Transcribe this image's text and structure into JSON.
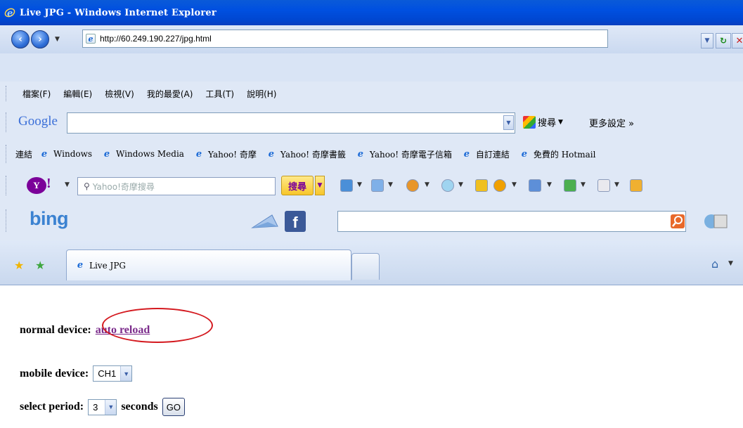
{
  "window": {
    "title": "Live JPG - Windows Internet Explorer"
  },
  "address": {
    "url": "http://60.249.190.227/jpg.html"
  },
  "menu": [
    "檔案(F)",
    "編輯(E)",
    "檢視(V)",
    "我的最愛(A)",
    "工具(T)",
    "說明(H)"
  ],
  "google": {
    "logo": "Google",
    "search_label": "搜尋",
    "more_settings": "更多設定 »"
  },
  "links": {
    "label": "連結",
    "items": [
      "Windows",
      "Windows Media",
      "Yahoo! 奇摩",
      "Yahoo! 奇摩書籤",
      "Yahoo! 奇摩電子信箱",
      "自訂連結",
      "免費的 Hotmail"
    ]
  },
  "yahoo": {
    "placeholder": "Yahoo!奇摩搜尋",
    "search_label": "搜尋"
  },
  "bing": {
    "logo": "bing"
  },
  "tabs": [
    {
      "label": "Live JPG"
    }
  ],
  "page": {
    "normal_label": "normal device:",
    "auto_reload": "auto reload",
    "mobile_label": "mobile device:",
    "channel": "CH1",
    "period_label": "select period:",
    "period": "3",
    "seconds_label": "seconds",
    "go": "GO"
  },
  "colors": {
    "titlebar": "#0050e0",
    "link_visited": "#7b2b8b",
    "annotation": "#d4191f"
  }
}
